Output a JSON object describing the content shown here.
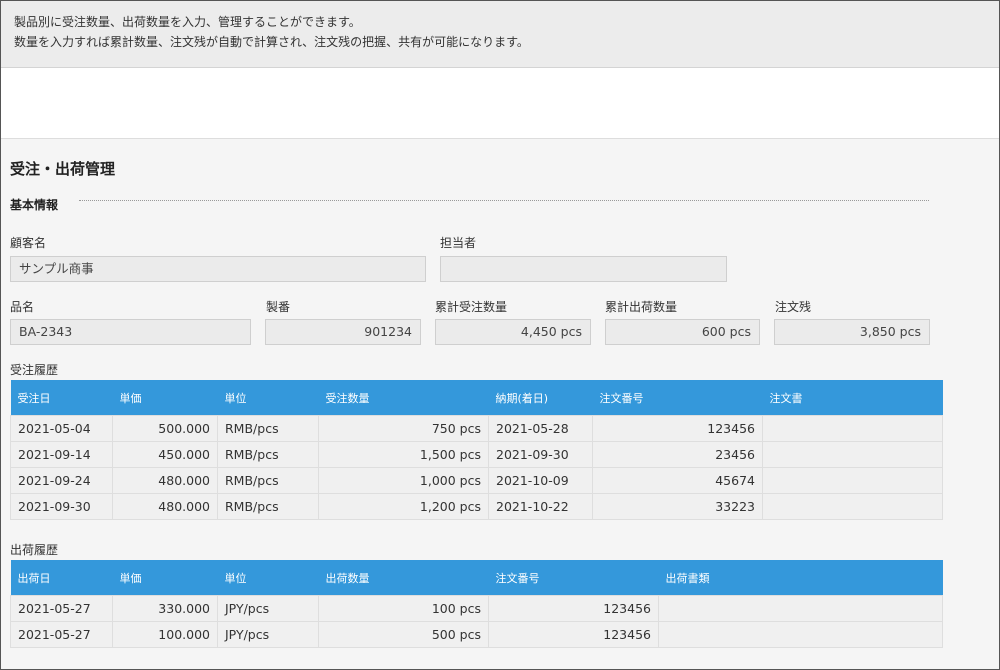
{
  "description": {
    "line1": "製品別に受注数量、出荷数量を入力、管理することができます。",
    "line2": "数量を入力すれば累計数量、注文残が自動で計算され、注文残の把握、共有が可能になります。"
  },
  "form": {
    "title": "受注・出荷管理",
    "section": "基本情報",
    "customer": {
      "label": "顧客名",
      "value": "サンプル商事"
    },
    "person": {
      "label": "担当者",
      "value": ""
    },
    "product": {
      "label": "品名",
      "value": "BA-2343"
    },
    "serial": {
      "label": "製番",
      "value": "901234"
    },
    "total_order": {
      "label": "累計受注数量",
      "value": "4,450 pcs"
    },
    "total_ship": {
      "label": "累計出荷数量",
      "value": "600 pcs"
    },
    "remaining": {
      "label": "注文残",
      "value": "3,850 pcs"
    }
  },
  "order_history": {
    "label": "受注履歴",
    "headers": [
      "受注日",
      "単価",
      "単位",
      "受注数量",
      "納期(着日)",
      "注文番号",
      "注文書"
    ],
    "rows": [
      [
        "2021-05-04",
        "500.000",
        "RMB/pcs",
        "750 pcs",
        "2021-05-28",
        "123456",
        ""
      ],
      [
        "2021-09-14",
        "450.000",
        "RMB/pcs",
        "1,500 pcs",
        "2021-09-30",
        "23456",
        ""
      ],
      [
        "2021-09-24",
        "480.000",
        "RMB/pcs",
        "1,000 pcs",
        "2021-10-09",
        "45674",
        ""
      ],
      [
        "2021-09-30",
        "480.000",
        "RMB/pcs",
        "1,200 pcs",
        "2021-10-22",
        "33223",
        ""
      ]
    ]
  },
  "ship_history": {
    "label": "出荷履歴",
    "headers": [
      "出荷日",
      "単価",
      "単位",
      "出荷数量",
      "注文番号",
      "出荷書類"
    ],
    "rows": [
      [
        "2021-05-27",
        "330.000",
        "JPY/pcs",
        "100 pcs",
        "123456",
        ""
      ],
      [
        "2021-05-27",
        "100.000",
        "JPY/pcs",
        "500 pcs",
        "123456",
        ""
      ]
    ]
  },
  "colors": {
    "header_bg": "#3498db",
    "field_bg": "#ebebeb"
  }
}
